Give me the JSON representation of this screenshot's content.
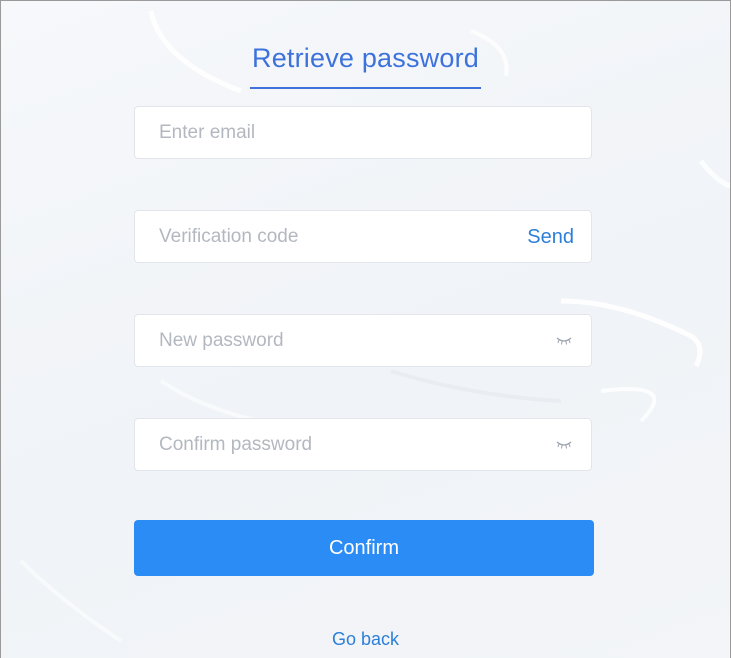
{
  "form": {
    "title": "Retrieve password",
    "email": {
      "placeholder": "Enter email",
      "value": ""
    },
    "verification": {
      "placeholder": "Verification code",
      "value": "",
      "send_label": "Send"
    },
    "new_password": {
      "placeholder": "New password",
      "value": "",
      "toggle_icon": "eye-closed-icon"
    },
    "confirm_password": {
      "placeholder": "Confirm password",
      "value": "",
      "toggle_icon": "eye-closed-icon"
    },
    "confirm_label": "Confirm",
    "back_label": "Go back"
  },
  "colors": {
    "accent": "#3d72db",
    "button": "#2b8cf5",
    "link": "#2b7fd8",
    "placeholder": "#b3b8c0",
    "field_border": "#e2e5ea"
  }
}
